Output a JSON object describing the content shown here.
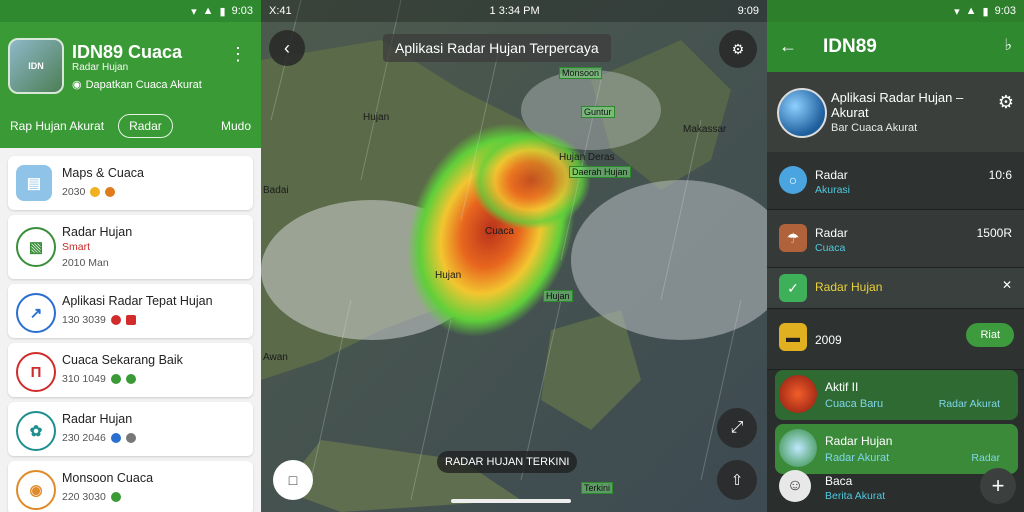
{
  "panel1": {
    "status_time": "9:03",
    "app_title": "IDN89 Cuaca",
    "subtitle": "Radar Hujan",
    "subtitle2": "Dapatkan Cuaca Akurat",
    "avatar_text": "IDN",
    "tabs": {
      "left": "Rap Hujan Akurat",
      "pill": "Radar",
      "right": "Mudo"
    },
    "items": [
      {
        "title": "Maps & Cuaca",
        "sub": "2030",
        "icon": "map-icon",
        "color": "#8fc3e8"
      },
      {
        "title": "Radar Hujan",
        "sub": "Smart",
        "sub2": "2010 Man",
        "icon": "bar-chart-icon",
        "color": "#3a8f3a"
      },
      {
        "title": "Aplikasi Radar Tepat Hujan",
        "sub": "130 3039",
        "icon": "trend-icon",
        "color": "#2a6fd0"
      },
      {
        "title": "Cuaca Sekarang Baik",
        "sub": "310 1049",
        "icon": "pin-icon",
        "color": "#d12c2c"
      },
      {
        "title": "Radar Hujan",
        "sub": "230 2046",
        "icon": "leaf-icon",
        "color": "#1e8f8f"
      },
      {
        "title": "Monsoon Cuaca",
        "sub": "220 3030",
        "icon": "globe-icon",
        "color": "#e08b2a"
      }
    ]
  },
  "panel2": {
    "status_time": "X:41",
    "status_center": "1 3:34 PM",
    "status_right": "9:09",
    "title": "Aplikasi Radar Hujan Terpercaya",
    "bottom_label": "RADAR HUJAN TERKINI",
    "labels": [
      "Monsoon",
      "Hujan",
      "Guntur",
      "Makassar",
      "Hujan Deras",
      "Daerah Hujan",
      "Badai",
      "Cuaca",
      "Hujan",
      "Hujan",
      "Awan",
      "Terkini"
    ]
  },
  "panel3": {
    "status_time": "9:03",
    "title": "IDN89",
    "hero_title": "Aplikasi Radar Hujan – Akurat",
    "hero_sub": "Bar Cuaca Akurat",
    "rows": [
      {
        "title": "Radar",
        "sub": "Akurasi",
        "right": "10:6"
      },
      {
        "title": "Radar",
        "sub": "Cuaca",
        "right": "1500R"
      },
      {
        "title": "Radar Hujan",
        "sub": "",
        "right": ""
      },
      {
        "title": "2009",
        "sub": "",
        "button": "Riat"
      }
    ],
    "green_items": [
      {
        "title": "Aktif II",
        "sub": "Cuaca Baru",
        "right": "Radar Akurat"
      },
      {
        "title": "Radar Hujan",
        "sub": "Radar Akurat",
        "right": "Radar"
      }
    ],
    "last": {
      "title": "Baca",
      "sub": "Berita Akurat"
    }
  }
}
